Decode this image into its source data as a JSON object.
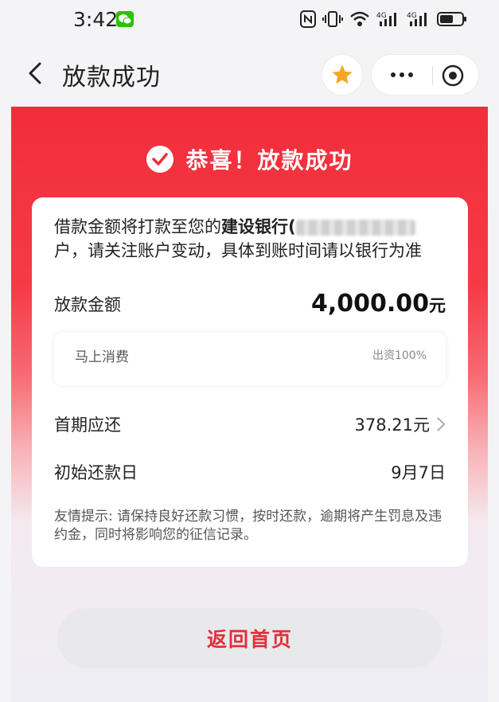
{
  "status_bar": {
    "time": "3:42"
  },
  "nav": {
    "title": "放款成功",
    "icons": [
      "back-icon",
      "star-icon",
      "more-icon",
      "record-icon"
    ]
  },
  "hero": {
    "title": "恭喜！放款成功"
  },
  "card": {
    "notice_prefix": "借款金额将打款至您的",
    "notice_bank": "建设银行",
    "notice_bank_suffix": "(",
    "notice_rest": "户，请关注账户变动，具体到账时间请以银行为准",
    "loan_amount_label": "放款金额",
    "loan_amount_value": "4,000.00",
    "loan_amount_unit": "元",
    "lender_name": "马上消费",
    "lender_share": "出资100%",
    "first_repayment_label": "首期应还",
    "first_repayment_value": "378.21元",
    "initial_repayment_date_label": "初始还款日",
    "initial_repayment_date_value": "9月7日",
    "tips_label": "友情提示:",
    "tips_text": "请保持良好还款习惯，按时还款，逾期将产生罚息及违约金，同时将影响您的征信记录。"
  },
  "actions": {
    "home_label": "返回首页"
  },
  "colors": {
    "accent_red": "#f22d3b",
    "button_text": "#e0303a",
    "star": "#f5a623"
  }
}
